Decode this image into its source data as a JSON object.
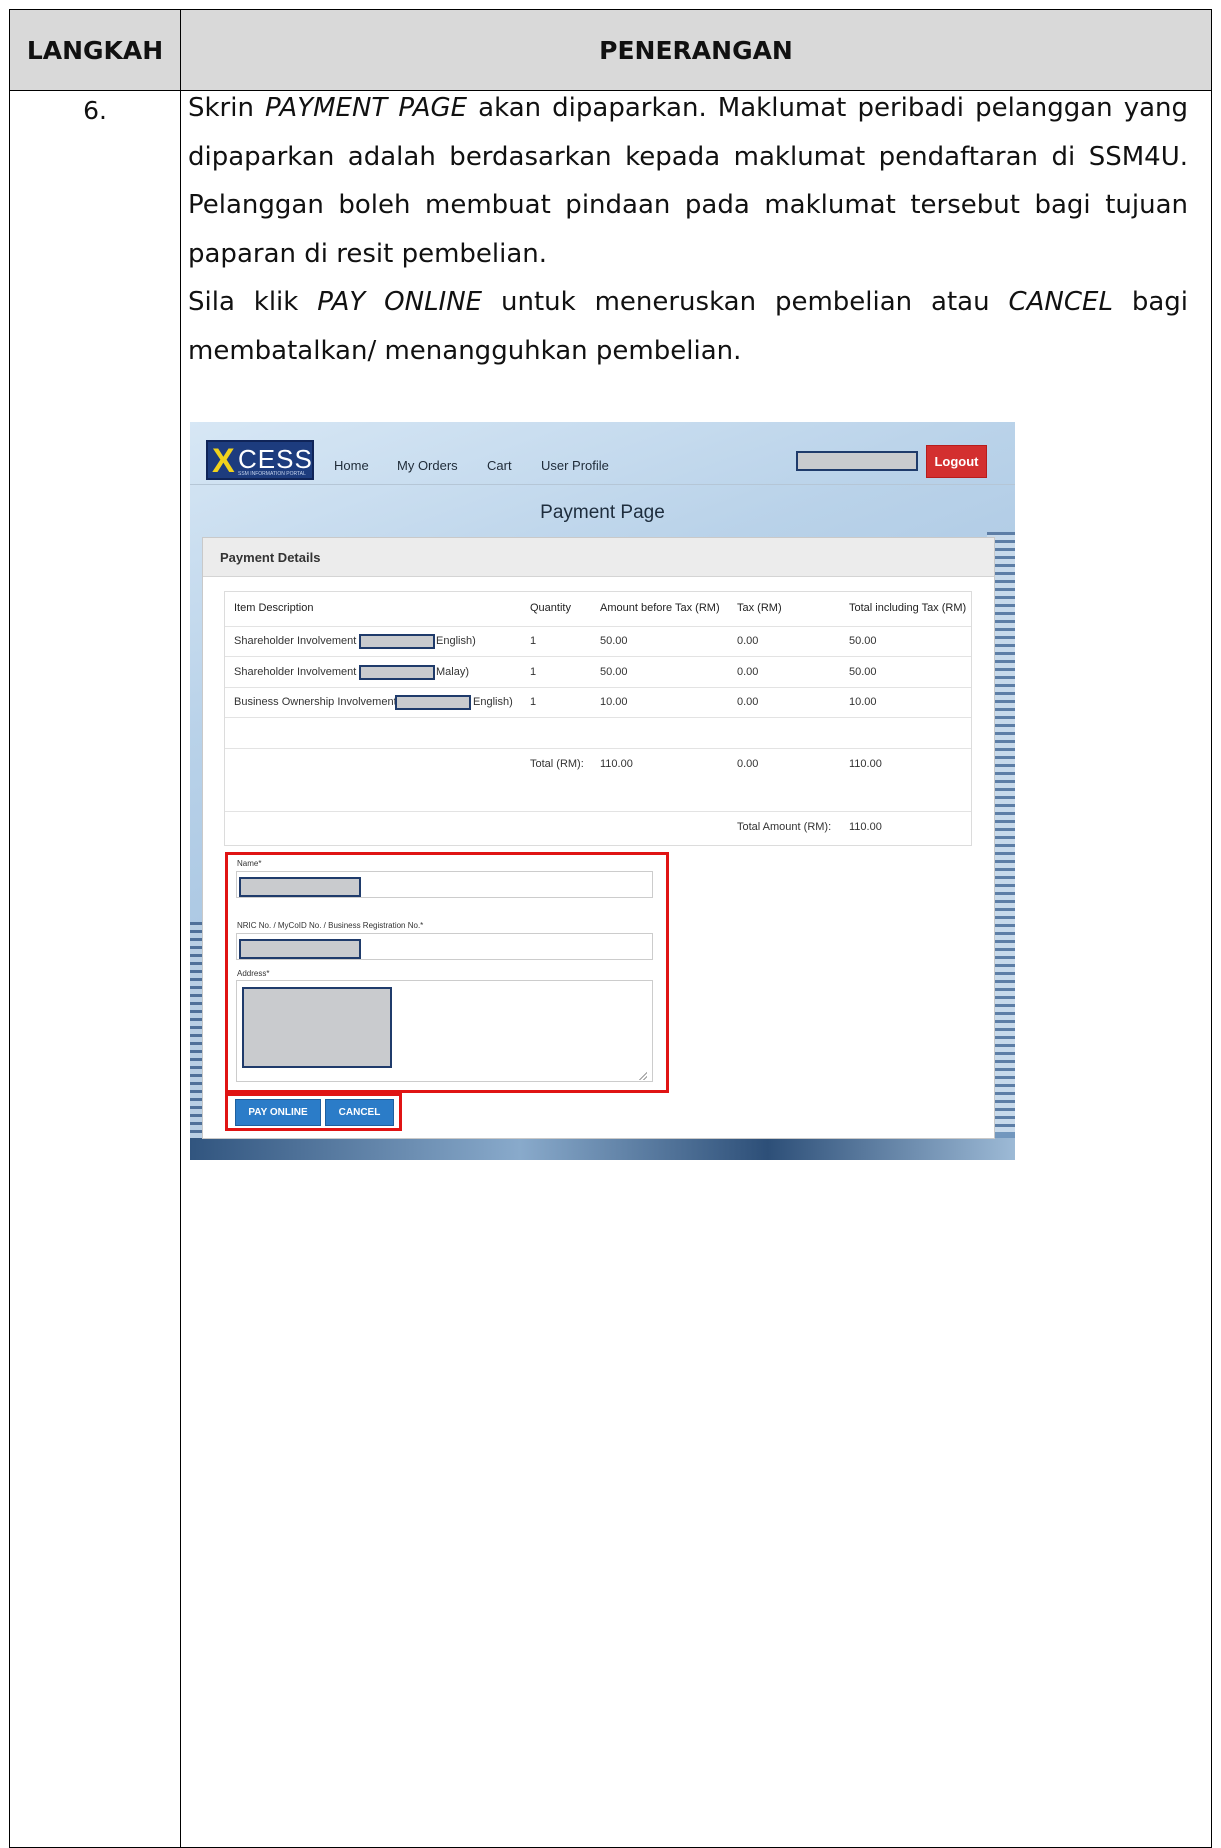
{
  "table": {
    "header_step": "LANGKAH",
    "header_desc": "PENERANGAN",
    "step_number": "6."
  },
  "description": {
    "p1_a": "Skrin ",
    "p1_b": "PAYMENT PAGE",
    "p1_c": " akan dipaparkan. Maklumat peribadi pelanggan yang dipaparkan adalah berdasarkan kepada maklumat pendaftaran di SSM4U. Pelanggan boleh membuat pindaan pada maklumat tersebut bagi tujuan paparan di resit pembelian.",
    "p2_a": "Sila klik ",
    "p2_b": "PAY ONLINE",
    "p2_c": " untuk meneruskan pembelian atau ",
    "p2_d": "CANCEL",
    "p2_e": " bagi membatalkan/ menangguhkan pembelian."
  },
  "screenshot": {
    "logo_x": "X",
    "logo_cess": "CESS",
    "logo_tag": "SSM INFORMATION PORTAL",
    "nav": [
      "Home",
      "My Orders",
      "Cart",
      "User Profile"
    ],
    "logout_label": "Logout",
    "page_title": "Payment Page",
    "panel_title": "Payment Details",
    "columns": [
      "Item Description",
      "Quantity",
      "Amount before Tax (RM)",
      "Tax (RM)",
      "Total including Tax (RM)"
    ],
    "rows": [
      {
        "desc_a": "Shareholder Involvement (",
        "desc_b": "English)",
        "qty": "1",
        "amount": "50.00",
        "tax": "0.00",
        "total": "50.00"
      },
      {
        "desc_a": "Shareholder Involvement (",
        "desc_b": "Malay)",
        "qty": "1",
        "amount": "50.00",
        "tax": "0.00",
        "total": "50.00"
      },
      {
        "desc_a": "Business Ownership Involvement (",
        "desc_b": "English)",
        "qty": "1",
        "amount": "10.00",
        "tax": "0.00",
        "total": "10.00"
      }
    ],
    "total_label": "Total (RM):",
    "total_amount": "110.00",
    "total_tax": "0.00",
    "total_incl": "110.00",
    "grand_label": "Total Amount (RM):",
    "grand_value": "110.00",
    "name_label": "Name*",
    "id_label": "NRIC No. / MyCoID No. / Business Registration No.*",
    "address_label": "Address*",
    "pay_label": "PAY ONLINE",
    "cancel_label": "CANCEL"
  }
}
